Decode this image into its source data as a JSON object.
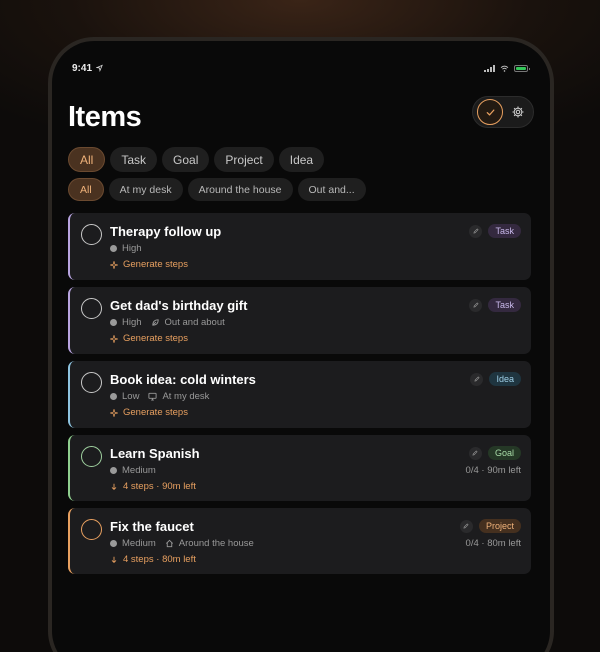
{
  "status_bar": {
    "time": "9:41"
  },
  "header": {
    "title": "Items"
  },
  "type_filters": [
    "All",
    "Task",
    "Goal",
    "Project",
    "Idea"
  ],
  "context_filters": [
    "All",
    "At my desk",
    "Around the house",
    "Out and..."
  ],
  "colors": {
    "accent": "#e8a060",
    "task": "#b8a4e0",
    "idea": "#8ec4e0",
    "goal": "#8fcf8f",
    "project": "#e8a060"
  },
  "items": [
    {
      "name": "Therapy follow up",
      "priority": "High",
      "context": "",
      "context_icon": "",
      "action": "Generate steps",
      "action_icon": "sparkle-icon",
      "type": "Task",
      "progress": ""
    },
    {
      "name": "Get dad's birthday gift",
      "priority": "High",
      "context": "Out and about",
      "context_icon": "leaf-icon",
      "action": "Generate steps",
      "action_icon": "sparkle-icon",
      "type": "Task",
      "progress": ""
    },
    {
      "name": "Book idea: cold winters",
      "priority": "Low",
      "context": "At my desk",
      "context_icon": "monitor-icon",
      "action": "Generate steps",
      "action_icon": "sparkle-icon",
      "type": "Idea",
      "progress": ""
    },
    {
      "name": "Learn Spanish",
      "priority": "Medium",
      "context": "",
      "context_icon": "",
      "action": "4 steps · 90m left",
      "action_icon": "arrow-down-icon",
      "type": "Goal",
      "progress": "0/4 · 90m left"
    },
    {
      "name": "Fix the faucet",
      "priority": "Medium",
      "context": "Around the house",
      "context_icon": "home-icon",
      "action": "4 steps · 80m left",
      "action_icon": "arrow-down-icon",
      "type": "Project",
      "progress": "0/4 · 80m left"
    }
  ]
}
